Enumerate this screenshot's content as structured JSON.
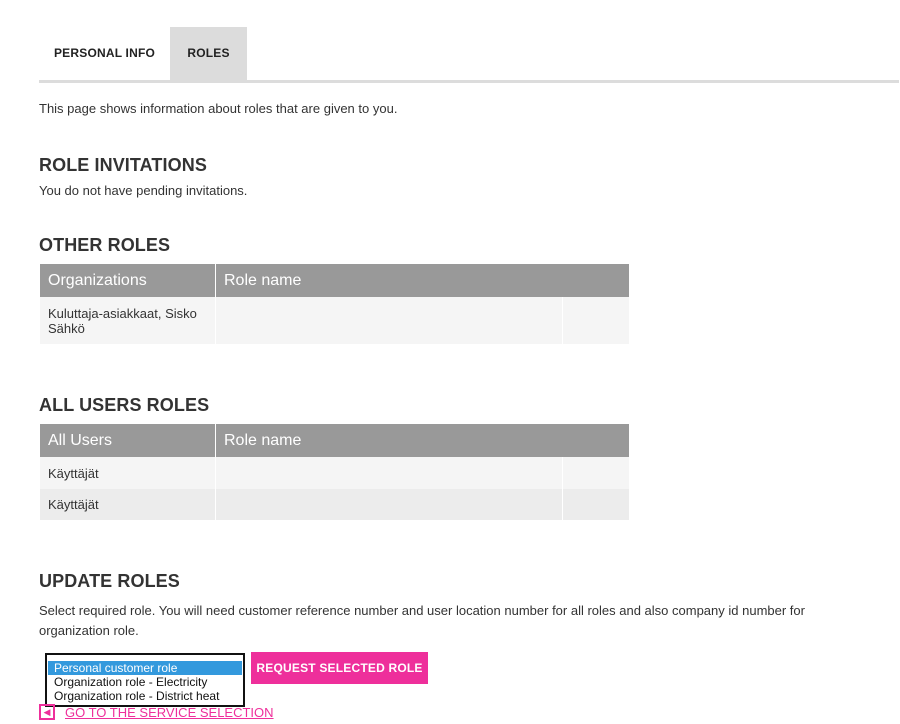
{
  "tabs": [
    {
      "label": "PERSONAL INFO",
      "active": false
    },
    {
      "label": "ROLES",
      "active": true
    }
  ],
  "intro": "This page shows information about roles that are given to you.",
  "role_invitations": {
    "title": "ROLE INVITATIONS",
    "message": "You do not have pending invitations."
  },
  "other_roles": {
    "title": "OTHER ROLES",
    "headers": [
      "Organizations",
      "Role name"
    ],
    "rows": [
      {
        "organization": "Kuluttaja-asiakkaat, Sisko Sähkö",
        "role_name": ""
      }
    ]
  },
  "all_users_roles": {
    "title": "ALL USERS ROLES",
    "headers": [
      "All Users",
      "Role name"
    ],
    "rows": [
      {
        "user": "Käyttäjät",
        "role_name": ""
      },
      {
        "user": "Käyttäjät",
        "role_name": ""
      }
    ]
  },
  "update_roles": {
    "title": "UPDATE ROLES",
    "description": "Select required role. You will need customer reference number and user location number for all roles and also company id number for organization role.",
    "options": [
      "Personal customer role",
      "Organization role - Electricity",
      "Organization role - District heat"
    ],
    "selected_index": 0,
    "request_button": "REQUEST SELECTED ROLE"
  },
  "service_link": {
    "label": "GO TO THE SERVICE SELECTION",
    "icon": "chevron-left-icon"
  },
  "colors": {
    "accent": "#ee2f9b",
    "table_header": "#999999",
    "tab_active": "#dcdcdc",
    "selection": "#3399dd"
  }
}
